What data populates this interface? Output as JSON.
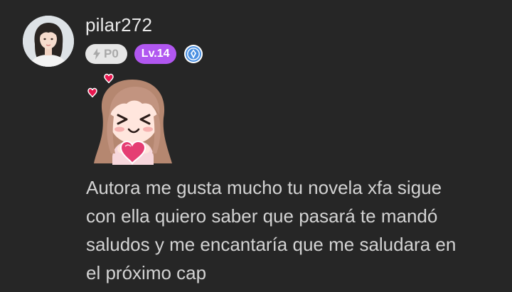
{
  "comment": {
    "username": "pilar272",
    "badges": {
      "points_label": "P0",
      "points_icon": "lightning-icon",
      "level_label": "Lv.14",
      "level_color": "#b157f0",
      "verified_icon": "blue-diamond-badge-icon",
      "verified_color": "#4a90e2"
    },
    "sticker": "chibi-girl-holding-heart-sticker",
    "text_lines": [
      "Autora me gusta mucho tu novela xfa sigue",
      "con ella quiero saber que pasará te mandó",
      "saludos y me encantaría que me saludara en",
      "el próximo cap"
    ]
  },
  "colors": {
    "background": "#262626",
    "username": "#e9e9e9",
    "text": "#d3d3d3"
  }
}
